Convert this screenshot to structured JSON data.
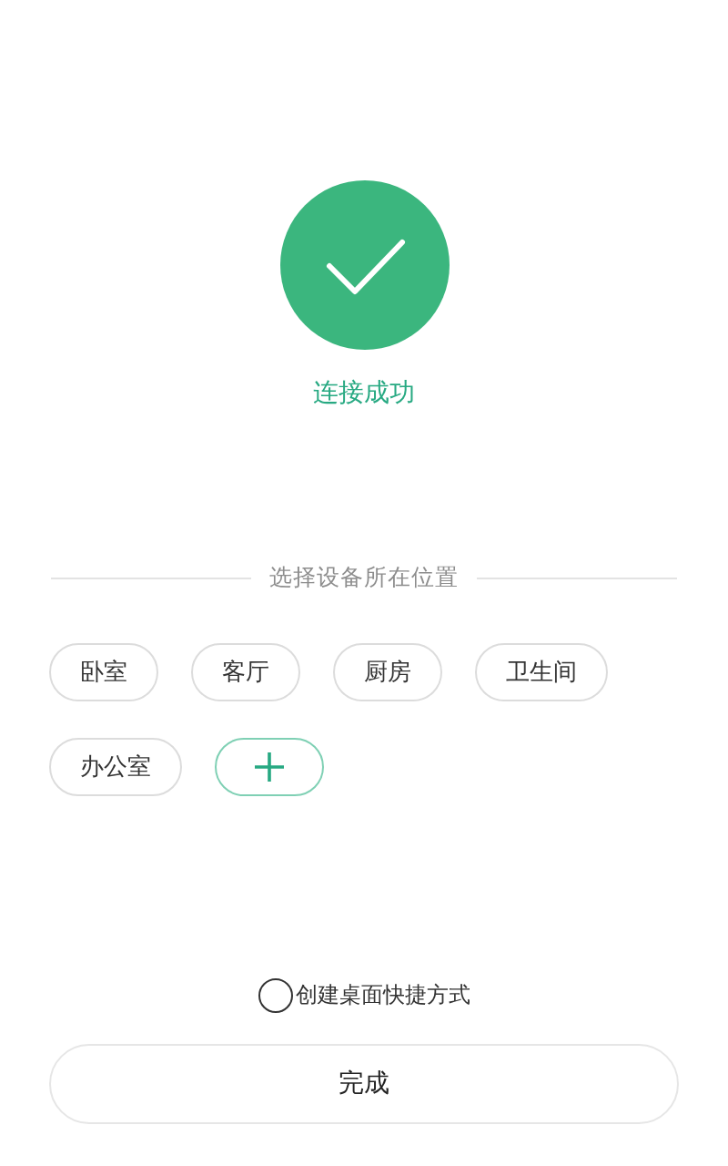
{
  "status": {
    "message": "连接成功"
  },
  "location_picker": {
    "title": "选择设备所在位置",
    "chips": [
      {
        "kind": "location",
        "label": "卧室"
      },
      {
        "kind": "location",
        "label": "客厅"
      },
      {
        "kind": "location",
        "label": "厨房"
      },
      {
        "kind": "location",
        "label": "卫生间"
      },
      {
        "kind": "location",
        "label": "办公室"
      },
      {
        "kind": "add"
      }
    ]
  },
  "shortcut": {
    "label": "创建桌面快捷方式",
    "checked": false
  },
  "done_button": {
    "label": "完成"
  }
}
